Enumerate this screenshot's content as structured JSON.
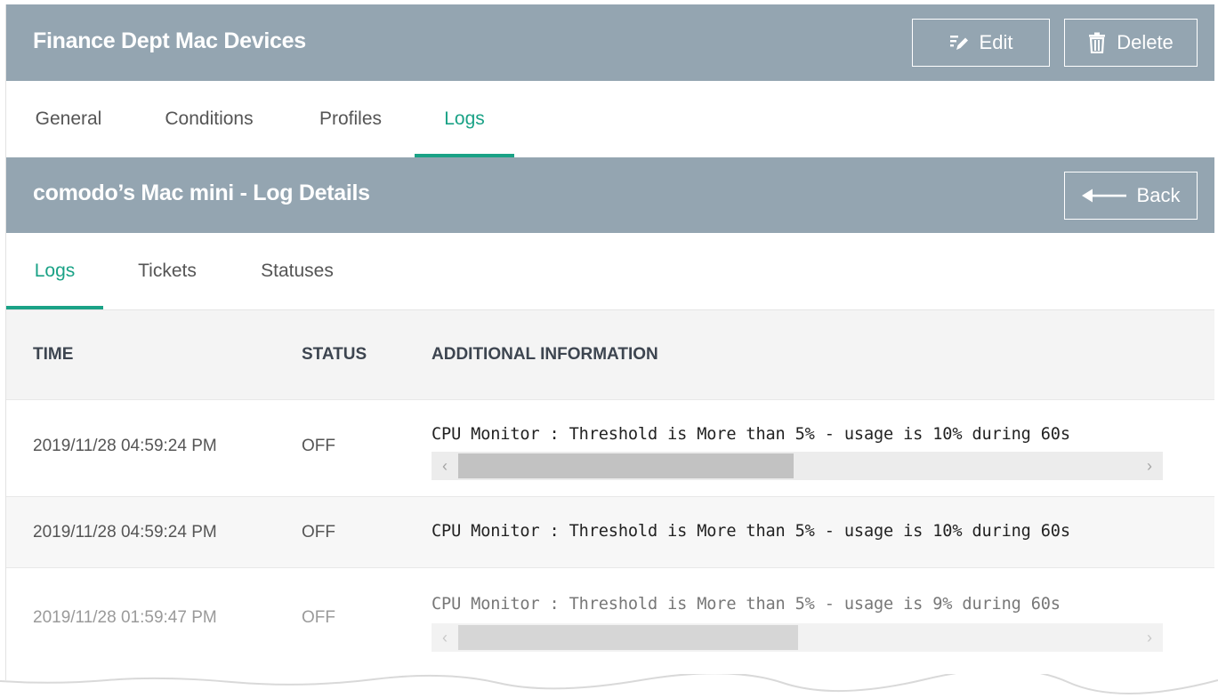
{
  "header": {
    "title": "Finance Dept Mac Devices",
    "edit_label": "Edit",
    "delete_label": "Delete"
  },
  "main_tabs": [
    {
      "label": "General",
      "active": false
    },
    {
      "label": "Conditions",
      "active": false
    },
    {
      "label": "Profiles",
      "active": false
    },
    {
      "label": "Logs",
      "active": true
    }
  ],
  "subheader": {
    "title": "comodo’s Mac mini - Log Details",
    "back_label": "Back"
  },
  "sub_tabs": [
    {
      "label": "Logs",
      "active": true
    },
    {
      "label": "Tickets",
      "active": false
    },
    {
      "label": "Statuses",
      "active": false
    }
  ],
  "table": {
    "columns": [
      "TIME",
      "STATUS",
      "ADDITIONAL INFORMATION"
    ],
    "rows": [
      {
        "time": "2019/11/28 04:59:24 PM",
        "status": "OFF",
        "info": "CPU Monitor : Threshold is More than 5% - usage is 10% during 60s",
        "has_scrollbar": true,
        "scroll_position": 0.3
      },
      {
        "time": "2019/11/28 04:59:24 PM",
        "status": "OFF",
        "info": "CPU Monitor : Threshold is More than 5% - usage is 10% during 60s",
        "has_scrollbar": false
      },
      {
        "time": "2019/11/28 01:59:47 PM",
        "status": "OFF",
        "info": "CPU Monitor : Threshold is More than 5% - usage is 9% during 60s",
        "has_scrollbar": true,
        "scroll_position": 0.3
      }
    ]
  },
  "colors": {
    "header_bg": "#94a5b1",
    "accent": "#1aa286",
    "table_header_bg": "#f4f4f4"
  },
  "icons": {
    "edit": "pencil-edit-icon",
    "delete": "trash-icon",
    "back": "arrow-left-icon",
    "scroll_left": "chevron-left-icon",
    "scroll_right": "chevron-right-icon"
  }
}
